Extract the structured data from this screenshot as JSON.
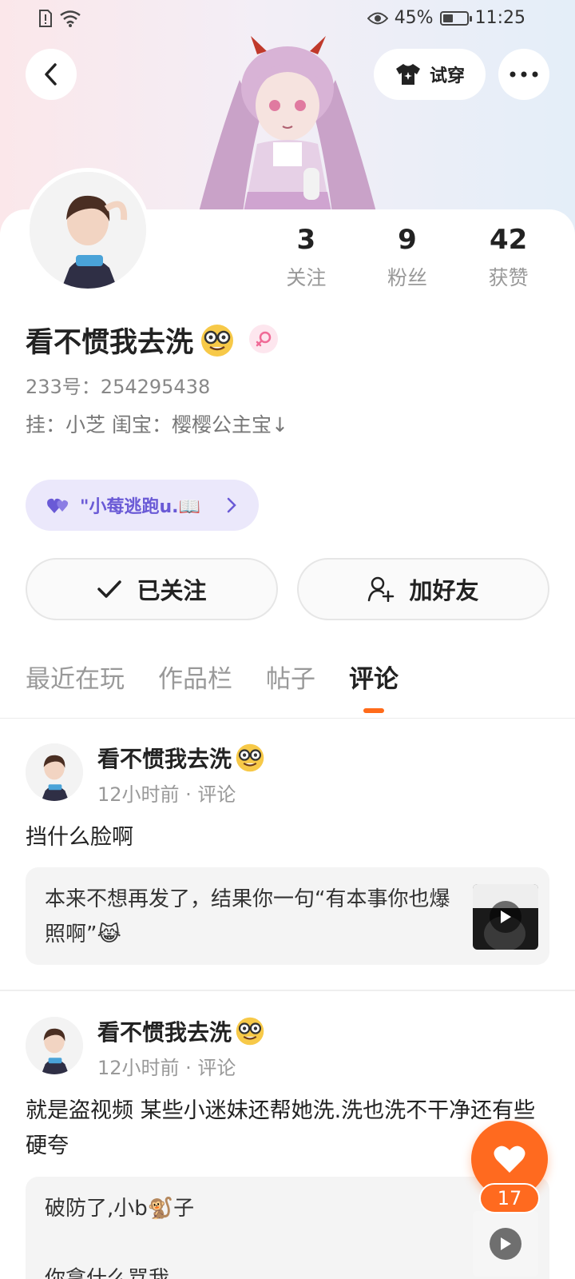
{
  "status_bar": {
    "battery": "45%",
    "battery_level": 0.45,
    "time": "11:25"
  },
  "header": {
    "try_on_label": "试穿"
  },
  "profile": {
    "nickname": "看不惯我去洗",
    "uid": "233号：254295438",
    "bio": "挂：小芝 闺宝：樱樱公主宝↓",
    "fan_link": "\"小莓逃跑u.📖",
    "stats": [
      {
        "value": "3",
        "label": "关注"
      },
      {
        "value": "9",
        "label": "粉丝"
      },
      {
        "value": "42",
        "label": "获赞"
      }
    ],
    "gender_color": "#f06b97"
  },
  "actions": {
    "follow_label": "已关注",
    "add_friend_label": "加好友"
  },
  "tabs": [
    {
      "label": "最近在玩",
      "active": false
    },
    {
      "label": "作品栏",
      "active": false
    },
    {
      "label": "帖子",
      "active": false
    },
    {
      "label": "评论",
      "active": true
    }
  ],
  "posts": [
    {
      "author": "看不惯我去洗",
      "meta": "12小时前 · 评论",
      "text": "挡什么脸啊",
      "quote": "本来不想再发了，结果你一句“有本事你也爆照啊”😹"
    },
    {
      "author": "看不惯我去洗",
      "meta": "12小时前 · 评论",
      "text": "就是盗视频 某些小迷妹还帮她洗.洗也洗不干净还有些硬夸",
      "quote_line1": "破防了,小b🐒子",
      "quote_line2": "你拿什么骂我"
    }
  ],
  "like_fab": {
    "count": "17"
  },
  "colors": {
    "accent": "#ff6a1f",
    "fan_pill_bg": "#ebe8fb",
    "fan_pill_text": "#6a5ad6"
  }
}
